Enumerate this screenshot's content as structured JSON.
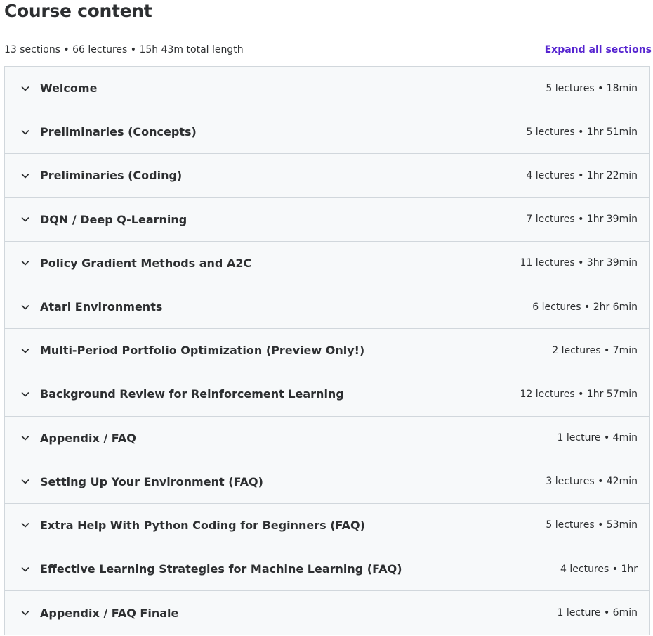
{
  "header": {
    "title": "Course content",
    "summary": "13 sections • 66 lectures • 15h 43m total length",
    "expand_all_label": "Expand all sections"
  },
  "colors": {
    "accent": "#5624d0",
    "text": "#2d2f31",
    "row_background": "#f7f9fa",
    "border": "#d1d7dc"
  },
  "sections": [
    {
      "title": "Welcome",
      "meta": "5 lectures • 18min",
      "icon": "chevron-down-icon"
    },
    {
      "title": "Preliminaries (Concepts)",
      "meta": "5 lectures • 1hr 51min",
      "icon": "chevron-down-icon"
    },
    {
      "title": "Preliminaries (Coding)",
      "meta": "4 lectures • 1hr 22min",
      "icon": "chevron-down-icon"
    },
    {
      "title": "DQN / Deep Q-Learning",
      "meta": "7 lectures • 1hr 39min",
      "icon": "chevron-down-icon"
    },
    {
      "title": "Policy Gradient Methods and A2C",
      "meta": "11 lectures • 3hr 39min",
      "icon": "chevron-down-icon"
    },
    {
      "title": "Atari Environments",
      "meta": "6 lectures • 2hr 6min",
      "icon": "chevron-down-icon"
    },
    {
      "title": "Multi-Period Portfolio Optimization (Preview Only!)",
      "meta": "2 lectures • 7min",
      "icon": "chevron-down-icon"
    },
    {
      "title": "Background Review for Reinforcement Learning",
      "meta": "12 lectures • 1hr 57min",
      "icon": "chevron-down-icon"
    },
    {
      "title": "Appendix / FAQ",
      "meta": "1 lecture • 4min",
      "icon": "chevron-down-icon"
    },
    {
      "title": "Setting Up Your Environment (FAQ)",
      "meta": "3 lectures • 42min",
      "icon": "chevron-down-icon"
    },
    {
      "title": "Extra Help With Python Coding for Beginners (FAQ)",
      "meta": "5 lectures • 53min",
      "icon": "chevron-down-icon"
    },
    {
      "title": "Effective Learning Strategies for Machine Learning (FAQ)",
      "meta": "4 lectures • 1hr",
      "icon": "chevron-down-icon"
    },
    {
      "title": "Appendix / FAQ Finale",
      "meta": "1 lecture • 6min",
      "icon": "chevron-down-icon"
    }
  ]
}
